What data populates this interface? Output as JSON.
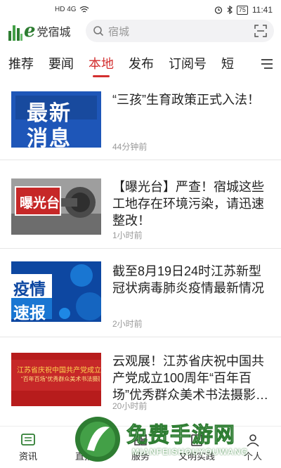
{
  "status_bar": {
    "left_indicators": "HD 4G",
    "battery": "75",
    "time": "11:41"
  },
  "header": {
    "logo_e": "e",
    "logo_text": "党宿城",
    "search_placeholder": "宿城"
  },
  "tabs": [
    {
      "label": "推荐",
      "active": false
    },
    {
      "label": "要闻",
      "active": false
    },
    {
      "label": "本地",
      "active": true
    },
    {
      "label": "发布",
      "active": false
    },
    {
      "label": "订阅号",
      "active": false
    },
    {
      "label": "短",
      "active": false
    }
  ],
  "news": [
    {
      "title": "“三孩”生育政策正式入法！",
      "time": "44分钟前",
      "thumb_text": [
        "最新",
        "消息"
      ]
    },
    {
      "title": "【曝光台】严查！宿城这些工地存在环境污染，请迅速整改！",
      "time": "1小时前",
      "thumb_text": [
        "曝光台"
      ]
    },
    {
      "title": "截至8月19日24时江苏新型冠状病毒肺炎疫情最新情况",
      "time": "2小时前",
      "thumb_text": [
        "疫情",
        "速报"
      ]
    },
    {
      "title": "云观展！江苏省庆祝中国共产党成立100周年“百年百场”优秀群众美术书法摄影…",
      "time": "20小时前",
      "thumb_text": [
        "江苏省庆祝中国共产党成立10",
        "“百年百场”优秀群众美术书法摄影"
      ]
    }
  ],
  "bottom_nav": [
    {
      "label": "资讯",
      "icon": "news-icon"
    },
    {
      "label": "直播",
      "icon": "live-icon"
    },
    {
      "label": "服务",
      "icon": "service-icon"
    },
    {
      "label": "文明实践",
      "icon": "civilization-icon"
    },
    {
      "label": "个人",
      "icon": "person-icon"
    }
  ],
  "watermark": {
    "text": "免费手游网",
    "sub": "MIANFEISHOUYOUWANG"
  },
  "colors": {
    "accent": "#d32f2f",
    "brand_green": "#2e7d32"
  }
}
